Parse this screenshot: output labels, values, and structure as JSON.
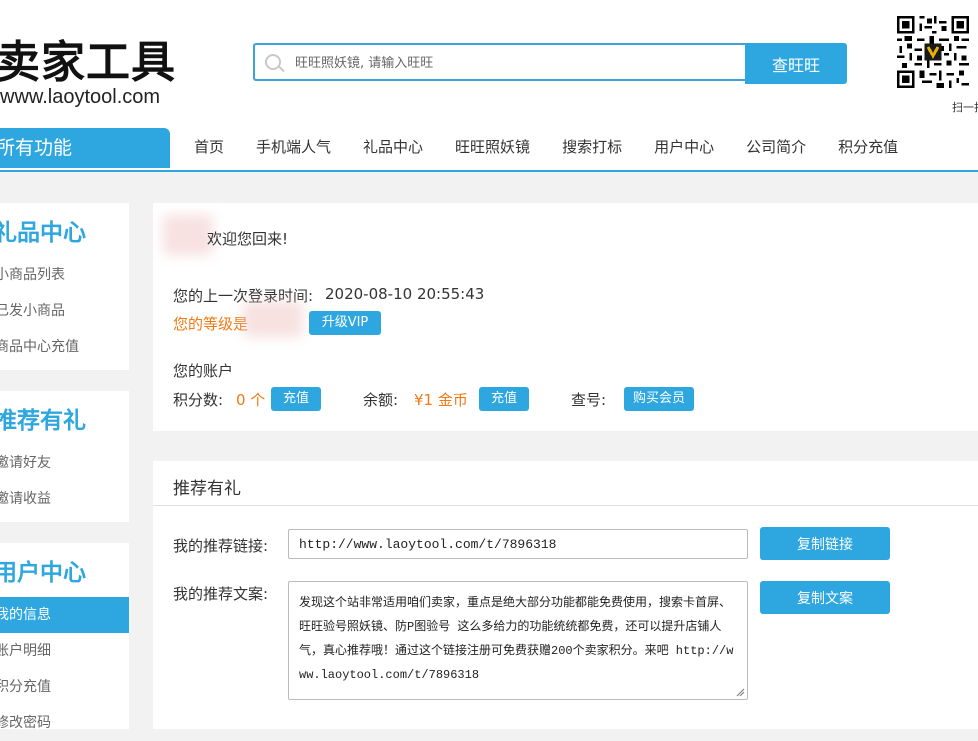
{
  "brand": {
    "title": "卖家工具",
    "url": "www.laoytool.com"
  },
  "search": {
    "placeholder": "旺旺照妖镜, 请输入旺旺",
    "value": "",
    "button_label": "查旺旺"
  },
  "qr": {
    "caption": "扫一扫"
  },
  "nav": {
    "all_functions": "所有功能",
    "items": [
      "首页",
      "手机端人气",
      "礼品中心",
      "旺旺照妖镜",
      "搜索打标",
      "用户中心",
      "公司简介",
      "积分充值"
    ]
  },
  "sidebar": {
    "gift": {
      "title": "礼品中心",
      "items": [
        "小商品列表",
        "已发小商品",
        "商品中心充值"
      ]
    },
    "referral": {
      "title": "推荐有礼",
      "items": [
        "邀请好友",
        "邀请收益"
      ]
    },
    "user": {
      "title": "用户中心",
      "items": [
        "我的信息",
        "账户明细",
        "积分充值",
        "修改密码"
      ],
      "active_index": 0
    }
  },
  "account": {
    "welcome": "欢迎您回来!",
    "last_login_label": "您的上一次登录时间:",
    "last_login_value": "2020-08-10 20:55:43",
    "level_label": "您的等级是",
    "upgrade_button": "升级VIP",
    "account_label": "您的账户",
    "points_label": "积分数:",
    "points_value": "0 个",
    "recharge_button": "充值",
    "balance_label": "余额:",
    "balance_value": "¥1 金币",
    "recharge_button_2": "充值",
    "query_label": "查号:",
    "buy_member_button": "购买会员"
  },
  "referral": {
    "title": "推荐有礼",
    "link_label": "我的推荐链接:",
    "link_value": "http://www.laoytool.com/t/7896318",
    "copy_link_button": "复制链接",
    "copy_label": "我的推荐文案:",
    "copy_text": "发现这个站非常适用咱们卖家，重点是绝大部分功能都能免费使用，搜索卡首屏、旺旺验号照妖镜、防P图验号 这么多给力的功能统统都免费，还可以提升店铺人气，真心推荐哦！通过这个链接注册可免费获赠200个卖家积分。来吧 http://www.laoytool.com/t/7896318",
    "copy_text_button": "复制文案"
  },
  "colors": {
    "accent": "#2ea7e0",
    "highlight": "#f07a13"
  }
}
